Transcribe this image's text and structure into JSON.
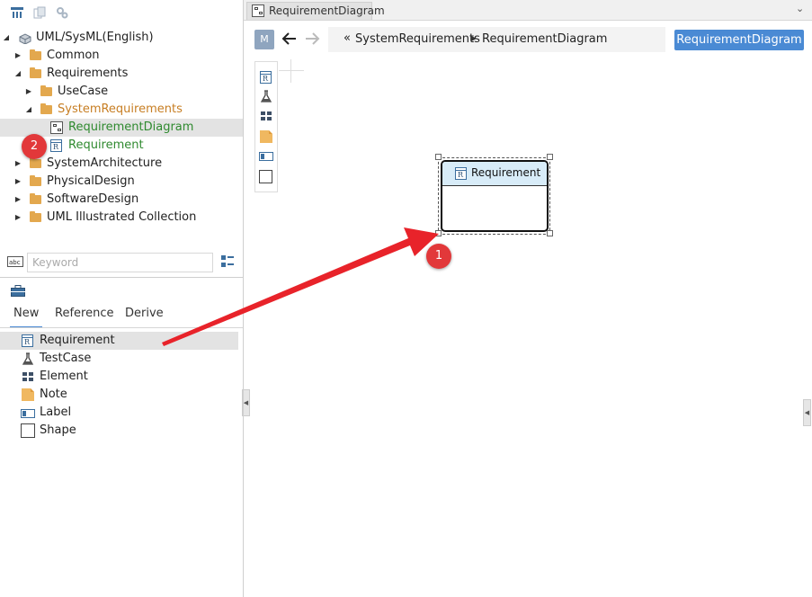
{
  "explorer": {
    "tree": [
      {
        "label": "UML/SysML(English)",
        "level": 0,
        "expanded": true
      },
      {
        "label": "Common",
        "level": 1,
        "expanded": false
      },
      {
        "label": "Requirements",
        "level": 1,
        "expanded": true
      },
      {
        "label": "UseCase",
        "level": 2,
        "expanded": false
      },
      {
        "label": "SystemRequirements",
        "level": 2,
        "expanded": true
      },
      {
        "label": "RequirementDiagram",
        "level": 3,
        "selected": true
      },
      {
        "label": "Requirement",
        "level": 3
      },
      {
        "label": "SystemArchitecture",
        "level": 1,
        "expanded": false
      },
      {
        "label": "PhysicalDesign",
        "level": 1,
        "expanded": false
      },
      {
        "label": "SoftwareDesign",
        "level": 1,
        "expanded": false
      },
      {
        "label": "UML Illustrated Collection",
        "level": 1,
        "expanded": false
      }
    ],
    "search_placeholder": "Keyword"
  },
  "toolbox": {
    "tabs": [
      "New",
      "Reference",
      "Derive"
    ],
    "active_tab": "New",
    "items": [
      {
        "label": "Requirement",
        "icon": "requirement-icon",
        "selected": true
      },
      {
        "label": "TestCase",
        "icon": "flask-icon"
      },
      {
        "label": "Element",
        "icon": "element-icon"
      },
      {
        "label": "Note",
        "icon": "note-icon"
      },
      {
        "label": "Label",
        "icon": "label-icon"
      },
      {
        "label": "Shape",
        "icon": "shape-icon"
      }
    ]
  },
  "editor": {
    "tab_title": "RequirementDiagram",
    "model_badge": "M",
    "breadcrumb": [
      "SystemRequirements",
      "RequirementDiagram"
    ],
    "diagram_button": "RequirementDiagram",
    "shape_title": "Requirement",
    "shape_icon_letter": "R"
  },
  "annotations": {
    "badge1": "1",
    "badge2": "2"
  },
  "colors": {
    "accent": "#4a8ad4",
    "folder": "#e3a84e",
    "badge": "#e2383a",
    "arrow": "#e8232a",
    "shape_header": "#d8ecf8"
  }
}
